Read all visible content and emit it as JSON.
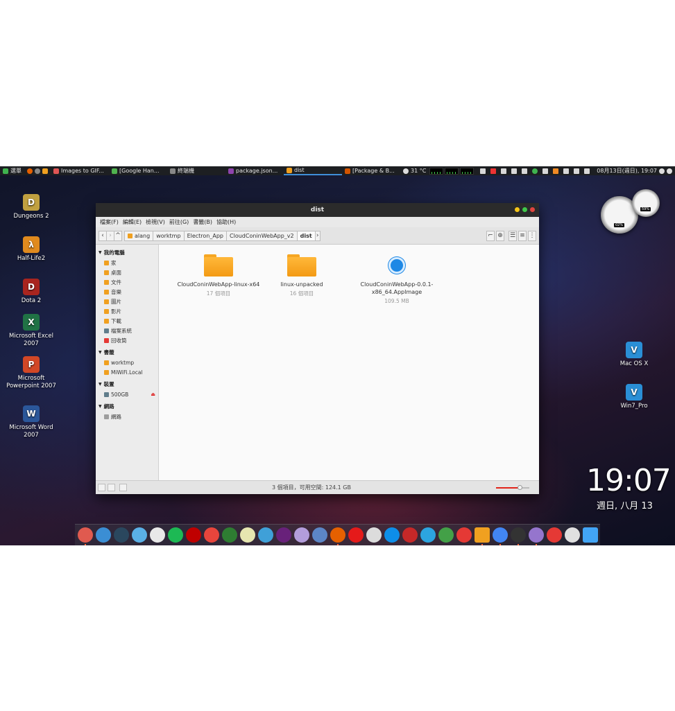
{
  "top_panel": {
    "menu_label": "選單",
    "tasks": [
      {
        "label": "Images to GIF...",
        "color": "#e05555",
        "active": false
      },
      {
        "label": "[Google Han...",
        "color": "#4fb34f",
        "active": false
      },
      {
        "label": "終端機",
        "color": "#888888",
        "active": false
      },
      {
        "label": "package.json...",
        "color": "#8e44ad",
        "active": false
      },
      {
        "label": "dist",
        "color": "#f0a020",
        "active": true
      },
      {
        "label": "[Package & B...",
        "color": "#d35400",
        "active": false
      }
    ],
    "temperature": "31 °C",
    "datetime": "08月13日(週日), 19:07"
  },
  "desktop_icons": [
    {
      "label": "Dungeons 2",
      "name": "dungeons2",
      "color": "#c0a040",
      "glyph": "D"
    },
    {
      "label": "Half-Life2",
      "name": "half-life2",
      "color": "#e08a1e",
      "glyph": "λ"
    },
    {
      "label": "Dota 2",
      "name": "dota2",
      "color": "#a8251f",
      "glyph": "D"
    },
    {
      "label": "Microsoft Excel 2007",
      "name": "excel",
      "color": "#207245",
      "glyph": "X"
    },
    {
      "label": "Microsoft Powerpoint 2007",
      "name": "powerpoint",
      "color": "#d24726",
      "glyph": "P"
    },
    {
      "label": "Microsoft Word 2007",
      "name": "word",
      "color": "#2b579a",
      "glyph": "W"
    },
    {
      "label": "Mac OS X",
      "name": "vbox-macosx",
      "color": "#2a8fd6",
      "glyph": "V"
    },
    {
      "label": "Win7_Pro",
      "name": "vbox-win7",
      "color": "#2a8fd6",
      "glyph": "V"
    }
  ],
  "window": {
    "title": "dist",
    "menu": [
      "檔案(F)",
      "編輯(E)",
      "檢視(V)",
      "前往(G)",
      "書籤(B)",
      "協助(H)"
    ],
    "breadcrumb": [
      "alang",
      "worktmp",
      "Electron_App",
      "CloudConinWebApp_v2",
      "dist"
    ],
    "sidebar": {
      "my_computer": {
        "heading": "我的電腦",
        "items": [
          {
            "label": "家",
            "color": "#f0a020"
          },
          {
            "label": "桌面",
            "color": "#f0a020"
          },
          {
            "label": "文件",
            "color": "#f0a020"
          },
          {
            "label": "音樂",
            "color": "#f0a020"
          },
          {
            "label": "圖片",
            "color": "#f0a020"
          },
          {
            "label": "影片",
            "color": "#f0a020"
          },
          {
            "label": "下載",
            "color": "#f0a020"
          },
          {
            "label": "檔案系統",
            "color": "#607d8b"
          },
          {
            "label": "回收筒",
            "color": "#e53935"
          }
        ]
      },
      "bookmarks": {
        "heading": "書籤",
        "items": [
          {
            "label": "worktmp",
            "color": "#f0a020"
          },
          {
            "label": "MiWiFi.Local",
            "color": "#f0a020"
          }
        ]
      },
      "devices": {
        "heading": "裝置",
        "items": [
          {
            "label": "500GB",
            "color": "#607d8b"
          }
        ]
      },
      "network": {
        "heading": "網路",
        "items": [
          {
            "label": "網路",
            "color": "#9e9e9e"
          }
        ]
      }
    },
    "files": [
      {
        "name": "CloudConinWebApp-linux-x64",
        "meta": "17 個項目",
        "type": "folder"
      },
      {
        "name": "linux-unpacked",
        "meta": "16 個項目",
        "type": "folder"
      },
      {
        "name": "CloudConinWebApp-0.0.1-x86_64.AppImage",
        "meta": "109.5 MB",
        "type": "appimage"
      }
    ],
    "status": "3 個項目，可用空間: 124.1 GB",
    "zoom_level": 0.7
  },
  "gauges": {
    "large_reading": "02%",
    "small_reading": "59%"
  },
  "clock": {
    "time": "19:07",
    "date": "週日, 八月 13"
  },
  "dock_apps": [
    {
      "name": "anchor",
      "color": "#e05a4f",
      "running": true
    },
    {
      "name": "browser-swirl",
      "color": "#3b8ed4",
      "running": false
    },
    {
      "name": "steam",
      "color": "#2a475e",
      "running": false
    },
    {
      "name": "network-globe",
      "color": "#5ab0e6",
      "running": false
    },
    {
      "name": "remote-desktop",
      "color": "#e8e8e8",
      "running": false
    },
    {
      "name": "spotify",
      "color": "#1db954",
      "running": false
    },
    {
      "name": "filezilla",
      "color": "#bf0000",
      "running": false
    },
    {
      "name": "phone",
      "color": "#e8453c",
      "running": false
    },
    {
      "name": "terminal-green",
      "color": "#2e7d32",
      "running": false
    },
    {
      "name": "puzzle",
      "color": "#e6e6b0",
      "running": false
    },
    {
      "name": "ide-blue",
      "color": "#3fa0d8",
      "running": false
    },
    {
      "name": "visual-studio",
      "color": "#68217a",
      "running": false
    },
    {
      "name": "document-viewer",
      "color": "#b39ddb",
      "running": false
    },
    {
      "name": "search-globe",
      "color": "#5c86c6",
      "running": false
    },
    {
      "name": "firefox",
      "color": "#e66000",
      "running": true
    },
    {
      "name": "opera",
      "color": "#e51a1a",
      "running": false
    },
    {
      "name": "leaf",
      "color": "#dcdcdc",
      "running": false
    },
    {
      "name": "teamviewer",
      "color": "#0e8ee9",
      "running": false
    },
    {
      "name": "diamond",
      "color": "#c62828",
      "running": false
    },
    {
      "name": "telegram",
      "color": "#2ca5e0",
      "running": false
    },
    {
      "name": "hangouts",
      "color": "#43a047",
      "running": false
    },
    {
      "name": "mail",
      "color": "#e53935",
      "running": false
    },
    {
      "name": "files",
      "color": "#f0a020",
      "running": true
    },
    {
      "name": "chrome",
      "color": "#4285f4",
      "running": true
    },
    {
      "name": "terminal",
      "color": "#333333",
      "running": true
    },
    {
      "name": "text-editor",
      "color": "#9575cd",
      "running": true
    },
    {
      "name": "trash",
      "color": "#e53935",
      "running": false
    },
    {
      "name": "safari",
      "color": "#e0e0e0",
      "running": false
    },
    {
      "name": "show-desktop",
      "color": "#42a5f5",
      "running": false
    }
  ]
}
